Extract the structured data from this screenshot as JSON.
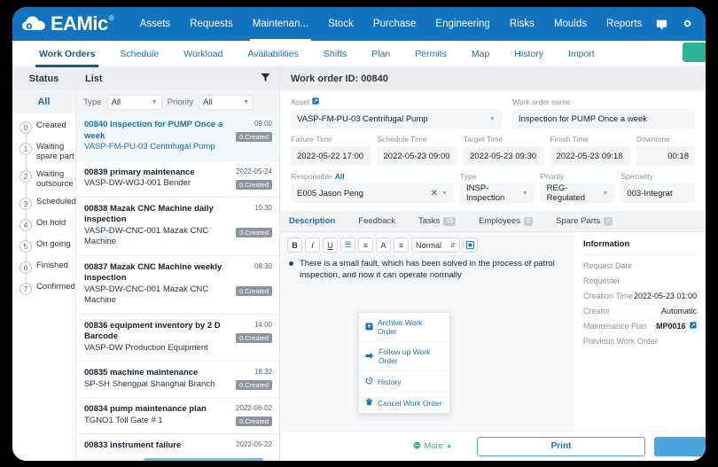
{
  "topnav": {
    "brand": "EAMic",
    "brand_mark": "®",
    "items": [
      {
        "label": "Assets"
      },
      {
        "label": "Requests"
      },
      {
        "label": "Maintenan..."
      },
      {
        "label": "Stock"
      },
      {
        "label": "Purchase"
      },
      {
        "label": "Engineering"
      },
      {
        "label": "Risks"
      },
      {
        "label": "Moulds"
      },
      {
        "label": "Reports"
      }
    ],
    "active": "Maintenan...",
    "icons": [
      {
        "name": "message-icon",
        "glyph": "▣"
      },
      {
        "name": "gear-icon",
        "glyph": "⚙"
      }
    ]
  },
  "subnav": {
    "items": [
      {
        "label": "Work Orders"
      },
      {
        "label": "Schedule"
      },
      {
        "label": "Workload"
      },
      {
        "label": "Availabilities"
      },
      {
        "label": "Shifts"
      },
      {
        "label": "Plan"
      },
      {
        "label": "Permits"
      },
      {
        "label": "Map"
      },
      {
        "label": "History"
      },
      {
        "label": "Import"
      }
    ],
    "active": "Work Orders"
  },
  "status_panel": {
    "header": "Status",
    "all_label": "All",
    "steps": [
      {
        "num": "0",
        "label": "Created"
      },
      {
        "num": "1",
        "label": "Waiting spare part"
      },
      {
        "num": "2",
        "label": "Waiting outsource"
      },
      {
        "num": "3",
        "label": "Scheduled"
      },
      {
        "num": "4",
        "label": "On hold"
      },
      {
        "num": "5",
        "label": "On going"
      },
      {
        "num": "6",
        "label": "Finished"
      },
      {
        "num": "7",
        "label": "Confirmed"
      }
    ]
  },
  "list_panel": {
    "header": "List",
    "filter_icon": "funnel-icon",
    "filters": [
      {
        "label": "Type",
        "value": "All"
      },
      {
        "label": "Priority",
        "value": "All"
      }
    ],
    "work_orders": [
      {
        "title": "00840 Inspection for PUMP Once a week",
        "asset": "VASP-FM-PU-03 Centrifugal Pump",
        "time": "09:00",
        "status": "0.Created",
        "selected": true
      },
      {
        "title": "00839 primary maintenance",
        "asset": "VASP-DW-WGJ-001 Bender",
        "time": "2022-05-24",
        "status": "0.Created",
        "selected": false
      },
      {
        "title": "00838 Mazak CNC Machine daily inspection",
        "asset": "VASP-DW-CNC-001 Mazak CNC Machine",
        "time": "10:30",
        "status": "0.Created",
        "selected": false
      },
      {
        "title": "00837 Mazak CNC Machine weekly inspection",
        "asset": "VASP-DW-CNC-001 Mazak CNC Machine",
        "time": "08:30",
        "status": "0.Created",
        "selected": false
      },
      {
        "title": "00836 equipment inventory by 2 D Barcode",
        "asset": "VASP-DW Production Equipment",
        "time": "14:00",
        "status": "0.Created",
        "selected": false
      },
      {
        "title": "00835 machine maintenance",
        "asset": "SP-SH Shengpai Shanghai Branch",
        "time": "18:32",
        "status": "0.Created",
        "selected": false
      },
      {
        "title": "00834 pump maintenance plan",
        "asset": "TGNO1 Toll Gate # 1",
        "time": "2022-06-02",
        "status": "0.Created",
        "selected": false
      },
      {
        "title": "00833 instrument failure",
        "asset": "",
        "time": "2022-05-22",
        "status": "",
        "selected": false
      }
    ]
  },
  "detail": {
    "header": "Work order ID: 00840",
    "asset_label": "Asset",
    "asset_link_icon": "external-link-icon",
    "asset_value": "VASP-FM-PU-03 Centrifugal Pump",
    "wo_name_label": "Work order name",
    "wo_name_value": "Inspection for PUMP Once a week",
    "times": [
      {
        "label": "Failure Time",
        "value": "2022-05-22 17:00"
      },
      {
        "label": "Schedule Time",
        "value": "2022-05-23 09:00"
      },
      {
        "label": "Target Time",
        "value": "2022-05-23 09:30"
      },
      {
        "label": "Finish Time",
        "value": "2022-05-23 09:18"
      },
      {
        "label": "Downtime",
        "value": "00:18"
      }
    ],
    "responsible_label": "Responsible",
    "responsible_all": "All",
    "responsible_value": "E005 Jason Peng",
    "type_label": "Type",
    "type_value": "INSP-Inspection",
    "priority_label": "Priority",
    "priority_value": "REG-Regulated",
    "speciality_label": "Speciality",
    "speciality_value": "003-Integrat",
    "tabs": [
      {
        "label": "Description",
        "count": null,
        "active": true
      },
      {
        "label": "Feedback",
        "count": null,
        "active": false
      },
      {
        "label": "Tasks",
        "count": "15",
        "active": false
      },
      {
        "label": "Employees",
        "count": "0",
        "active": false
      },
      {
        "label": "Spare Parts",
        "count": "0",
        "active": false
      }
    ],
    "editor": {
      "buttons": [
        {
          "name": "bold-icon",
          "glyph": "B",
          "blue": false
        },
        {
          "name": "italic-icon",
          "glyph": "I",
          "blue": false
        },
        {
          "name": "underline-icon",
          "glyph": "U",
          "blue": false
        },
        {
          "name": "bullet-list-icon",
          "glyph": "☰",
          "blue": true
        },
        {
          "name": "numbered-list-icon",
          "glyph": "≡",
          "blue": false
        },
        {
          "name": "text-color-icon",
          "glyph": "A",
          "blue": false
        },
        {
          "name": "align-icon",
          "glyph": "≡",
          "blue": false
        }
      ],
      "format_value": "Normal",
      "image_button": "insert-image-icon",
      "text": "There is a small fault, which has been solved in the process of patrol inspection, and now it can operate normally"
    },
    "menu": [
      {
        "label": "Archive Work Order",
        "icon": "archive-icon",
        "glyph": "▣"
      },
      {
        "label": "Follow up Work Order",
        "icon": "arrow-right-icon",
        "glyph": "➡"
      },
      {
        "label": "History",
        "icon": "history-icon",
        "glyph": "↺"
      },
      {
        "label": "Cancel Work Order",
        "icon": "trash-icon",
        "glyph": "Ὕ1"
      }
    ],
    "info": {
      "title": "Information",
      "rows": [
        {
          "key": "Request Date",
          "value": ""
        },
        {
          "key": "Requester",
          "value": ""
        },
        {
          "key": "Creation Time",
          "value": "2022-05-23 01:00"
        },
        {
          "key": "Creator",
          "value": "Automatic"
        },
        {
          "key": "Maintenance Plan",
          "value": "MP0016",
          "ext": true
        },
        {
          "key": "Previous Work Order",
          "value": ""
        }
      ]
    }
  },
  "footer": {
    "more_label": "More",
    "more_icon": "minus-circle-icon",
    "more_caret": "▲",
    "print_label": "Print"
  },
  "colors": {
    "brand_blue": "#1273C0",
    "accent_green": "#2EB398",
    "button_blue": "#4aa3dd",
    "badge_gray": "#8b94a0",
    "scrollbar_teal": "#5ec8d8"
  }
}
